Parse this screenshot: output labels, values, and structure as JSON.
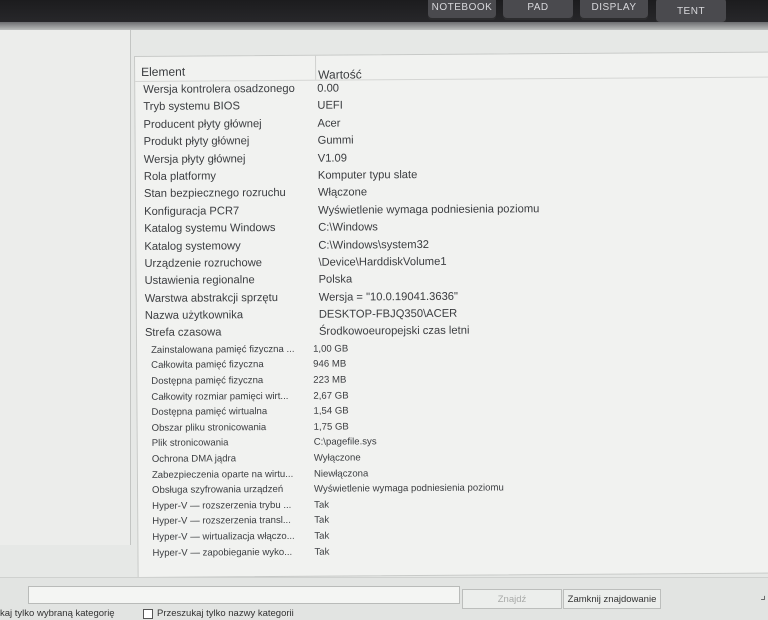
{
  "bezel": {
    "buttons": [
      "NOTEBOOK",
      "PAD",
      "DISPLAY",
      "TENT"
    ]
  },
  "table": {
    "header_element": "Element",
    "header_value": "Wartość",
    "rows": [
      {
        "k": "Wersja kontrolera osadzonego",
        "v": "0.00"
      },
      {
        "k": "Tryb systemu BIOS",
        "v": "UEFI"
      },
      {
        "k": "Producent płyty głównej",
        "v": "Acer"
      },
      {
        "k": "Produkt płyty głównej",
        "v": "Gummi"
      },
      {
        "k": "Wersja płyty głównej",
        "v": "V1.09"
      },
      {
        "k": "Rola platformy",
        "v": "Komputer typu slate"
      },
      {
        "k": "Stan bezpiecznego rozruchu",
        "v": "Włączone"
      },
      {
        "k": "Konfiguracja PCR7",
        "v": "Wyświetlenie wymaga podniesienia poziomu"
      },
      {
        "k": "Katalog systemu Windows",
        "v": "C:\\Windows"
      },
      {
        "k": "Katalog systemowy",
        "v": "C:\\Windows\\system32"
      },
      {
        "k": "Urządzenie rozruchowe",
        "v": "\\Device\\HarddiskVolume1"
      },
      {
        "k": "Ustawienia regionalne",
        "v": "Polska"
      },
      {
        "k": "Warstwa abstrakcji sprzętu",
        "v": "Wersja = \"10.0.19041.3636\""
      },
      {
        "k": "Nazwa użytkownika",
        "v": "DESKTOP-FBJQ350\\ACER"
      },
      {
        "k": "Strefa czasowa",
        "v": "Środkowoeuropejski czas letni"
      },
      {
        "k": "Zainstalowana pamięć fizyczna ...",
        "v": "1,00 GB"
      },
      {
        "k": "Całkowita pamięć fizyczna",
        "v": "946 MB"
      },
      {
        "k": "Dostępna pamięć fizyczna",
        "v": "223 MB"
      },
      {
        "k": "Całkowity rozmiar pamięci wirt...",
        "v": "2,67 GB"
      },
      {
        "k": "Dostępna pamięć wirtualna",
        "v": "1,54 GB"
      },
      {
        "k": "Obszar pliku stronicowania",
        "v": "1,75 GB"
      },
      {
        "k": "Plik stronicowania",
        "v": "C:\\pagefile.sys"
      },
      {
        "k": "Ochrona DMA jądra",
        "v": "Wyłączone"
      },
      {
        "k": "Zabezpieczenia oparte na wirtu...",
        "v": "Niewłączona"
      },
      {
        "k": "Obsługa szyfrowania urządzeń",
        "v": "Wyświetlenie wymaga podniesienia poziomu"
      },
      {
        "k": "Hyper-V — rozszerzenia trybu ...",
        "v": "Tak"
      },
      {
        "k": "Hyper-V — rozszerzenia transl...",
        "v": "Tak"
      },
      {
        "k": "Hyper-V — wirtualizacja włączo...",
        "v": "Tak"
      },
      {
        "k": "Hyper-V — zapobieganie wyko...",
        "v": "Tak"
      }
    ]
  },
  "findbar": {
    "find_label": "Znajdź",
    "close_find_label": "Zamknij znajdowanie",
    "search_selected_label": "kaj tylko wybraną kategorię",
    "search_names_label": "Przeszukaj tylko nazwy kategorii"
  }
}
